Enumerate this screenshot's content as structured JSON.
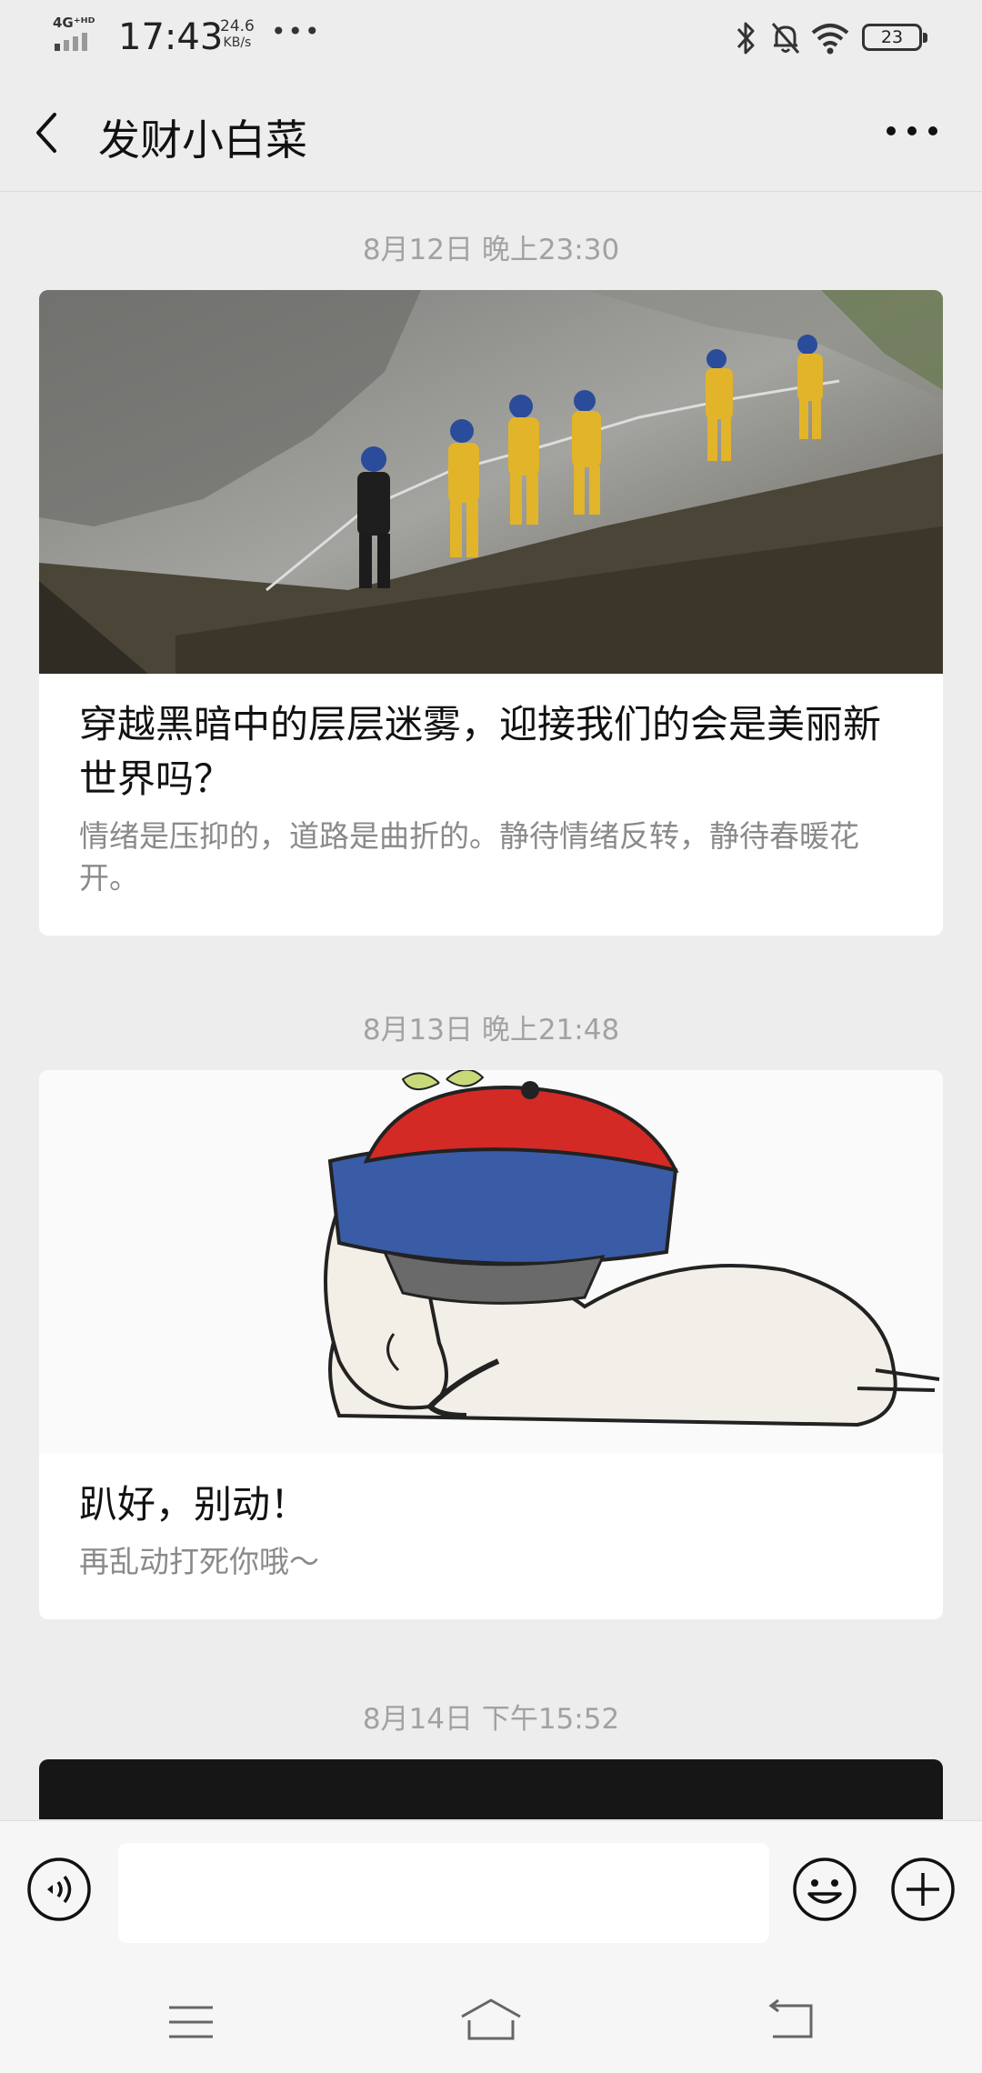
{
  "status_bar": {
    "network_type": "4G⁺ᴴᴰ",
    "time": "17:43",
    "speed_value": "24.6",
    "speed_unit": "KB/s",
    "more_indicator": "•••",
    "battery_level": "23"
  },
  "header": {
    "title": "发财小白菜"
  },
  "feed": {
    "items": [
      {
        "timestamp": "8月12日 晚上23:30",
        "title": "穿越黑暗中的层层迷雾，迎接我们的会是美丽新世界吗？",
        "description": "情绪是压抑的，道路是曲折的。静待情绪反转，静待春暖花开。"
      },
      {
        "timestamp": "8月13日 晚上21:48",
        "title": "趴好，别动！",
        "description": "再乱动打死你哦～"
      },
      {
        "timestamp": "8月14日 下午15:52"
      }
    ]
  },
  "input_bar": {
    "voice_icon": "voice-icon",
    "emoji_icon": "emoji-icon",
    "plus_icon": "plus-icon",
    "placeholder": ""
  },
  "colors": {
    "background": "#ededed",
    "card": "#ffffff",
    "timestamp": "#a2a2a2",
    "desc": "#8a8a8a",
    "hat_red": "#d32a26",
    "hat_blue": "#3a5ba6",
    "worker_yellow": "#e2b42a"
  }
}
